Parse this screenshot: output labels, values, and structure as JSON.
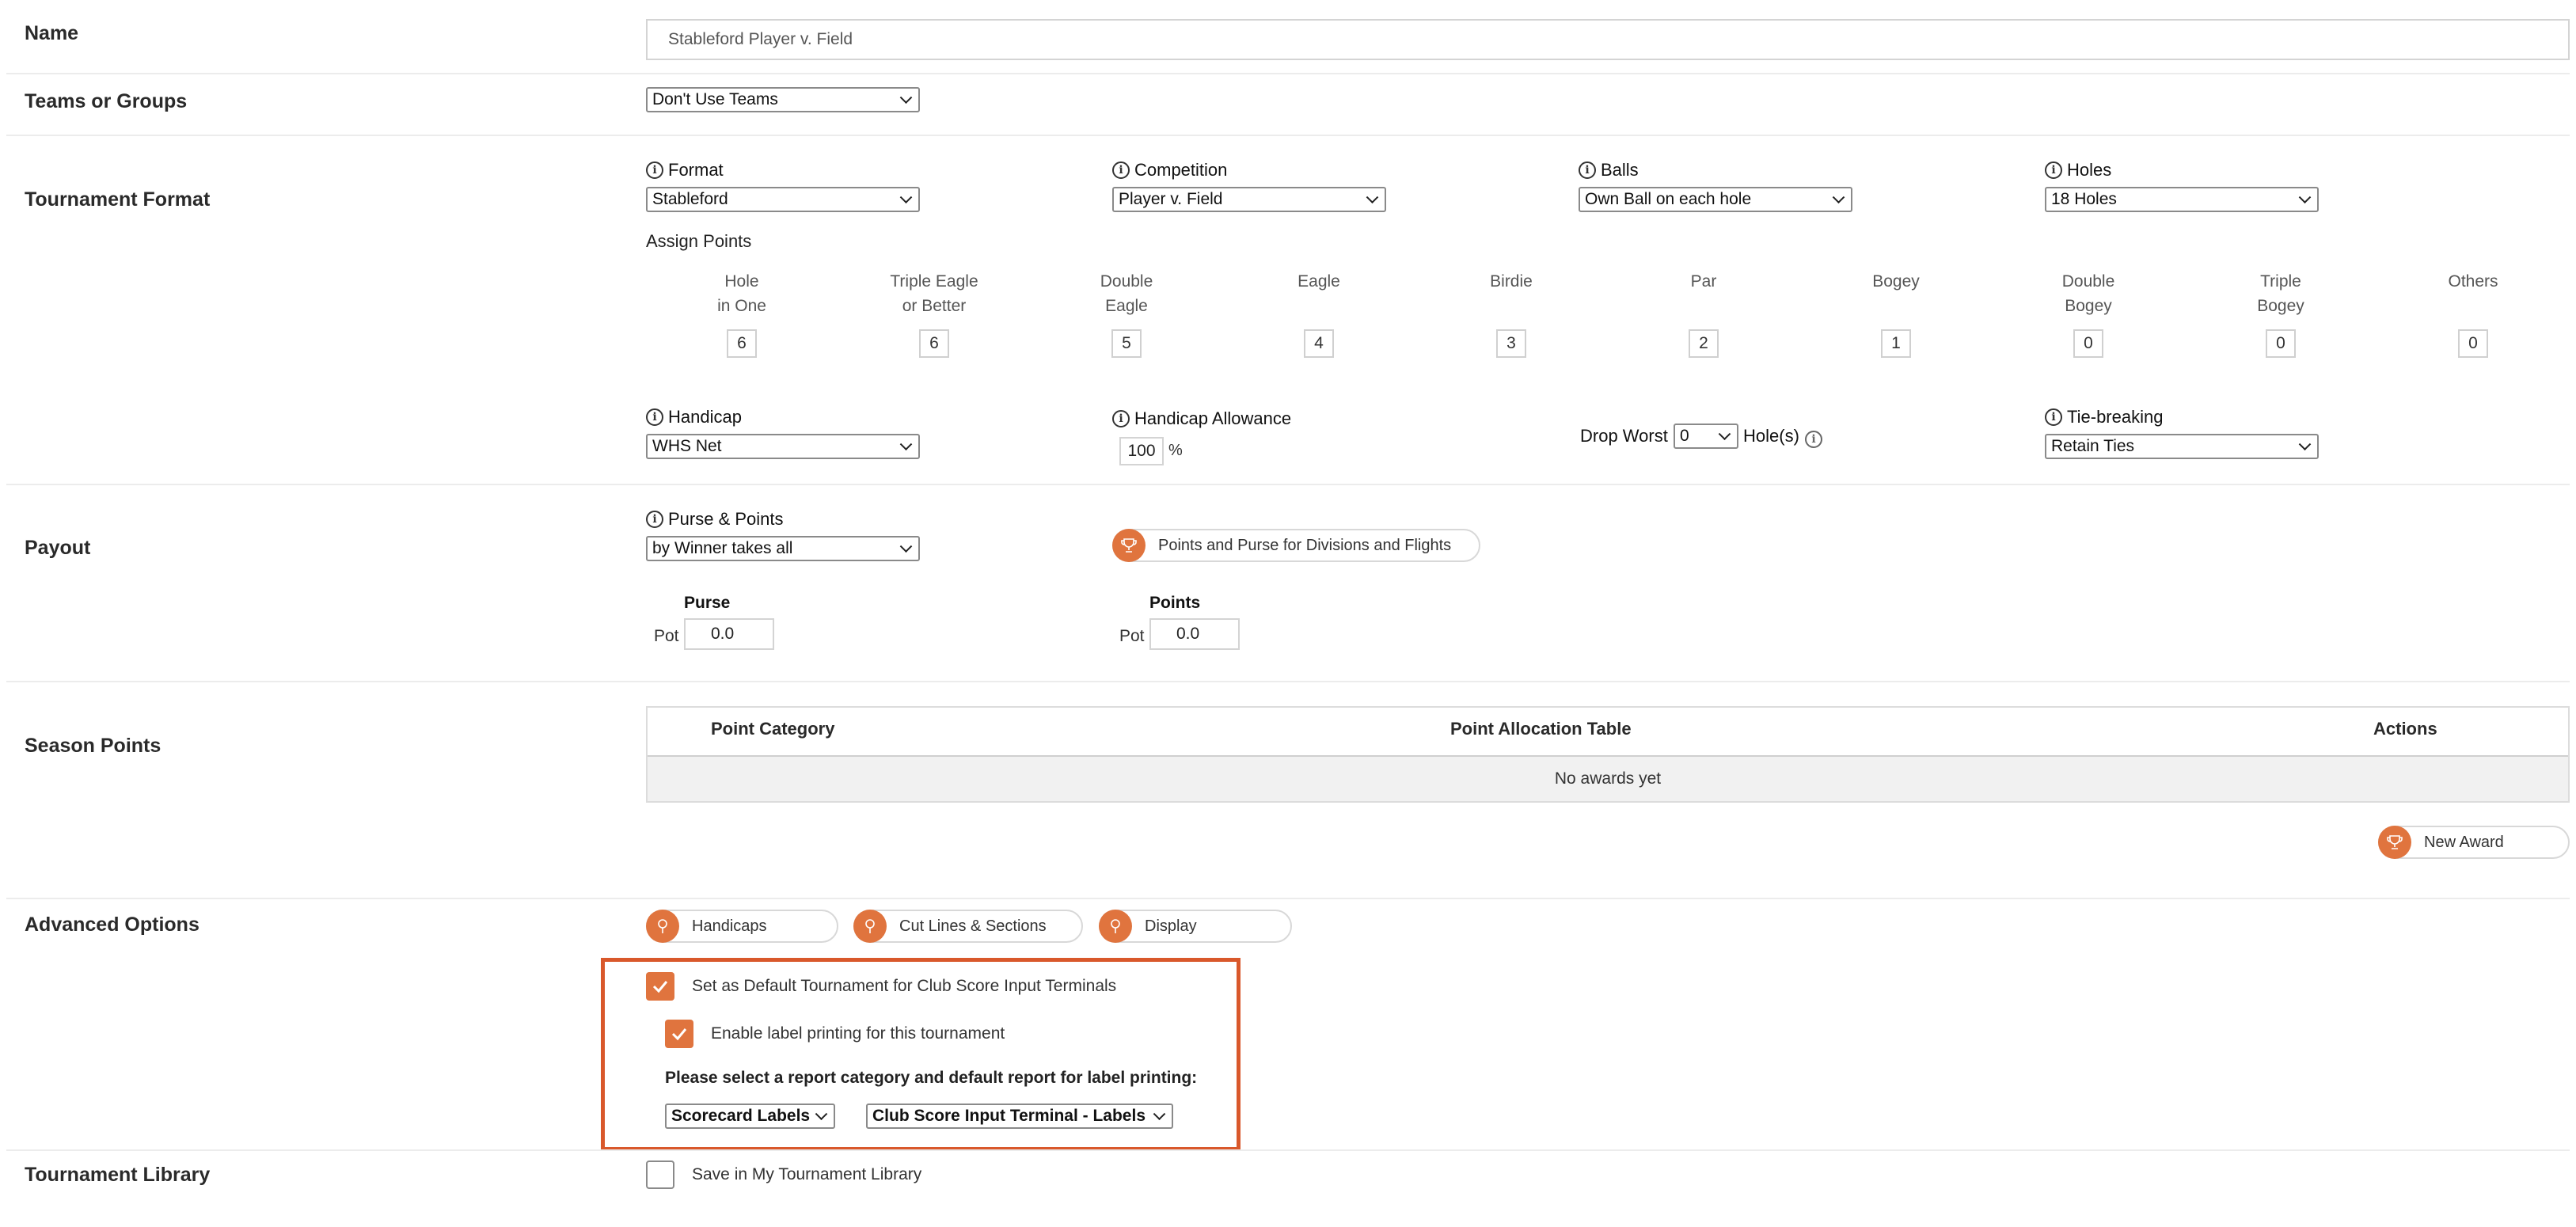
{
  "name_row": {
    "label": "Name",
    "value": "Stableford Player v. Field"
  },
  "teams_row": {
    "label": "Teams or Groups",
    "select": "Don't Use Teams"
  },
  "format_row": {
    "label": "Tournament Format",
    "format": {
      "label": "Format",
      "value": "Stableford"
    },
    "competition": {
      "label": "Competition",
      "value": "Player v. Field"
    },
    "balls": {
      "label": "Balls",
      "value": "Own Ball on each hole"
    },
    "holes": {
      "label": "Holes",
      "value": "18 Holes"
    },
    "assign_points_label": "Assign Points",
    "points": [
      {
        "line1": "Hole",
        "line2": "in One",
        "value": "6"
      },
      {
        "line1": "Triple Eagle",
        "line2": "or Better",
        "value": "6"
      },
      {
        "line1": "Double",
        "line2": "Eagle",
        "value": "5"
      },
      {
        "line1": "Eagle",
        "line2": "",
        "value": "4"
      },
      {
        "line1": "Birdie",
        "line2": "",
        "value": "3"
      },
      {
        "line1": "Par",
        "line2": "",
        "value": "2"
      },
      {
        "line1": "Bogey",
        "line2": "",
        "value": "1"
      },
      {
        "line1": "Double",
        "line2": "Bogey",
        "value": "0"
      },
      {
        "line1": "Triple",
        "line2": "Bogey",
        "value": "0"
      },
      {
        "line1": "Others",
        "line2": "",
        "value": "0"
      }
    ],
    "handicap": {
      "label": "Handicap",
      "value": "WHS Net"
    },
    "allowance": {
      "label": "Handicap Allowance",
      "value": "100",
      "unit": "%"
    },
    "drop_worst": {
      "label": "Drop Worst",
      "value": "0",
      "suffix": "Hole(s)"
    },
    "tie_breaking": {
      "label": "Tie-breaking",
      "value": "Retain Ties"
    }
  },
  "payout_row": {
    "label": "Payout",
    "purse_points": {
      "label": "Purse & Points",
      "value": "by Winner takes all"
    },
    "divisions_button": "Points and Purse for Divisions and Flights",
    "purse": {
      "header": "Purse",
      "pot_label": "Pot",
      "value": "0.0"
    },
    "points": {
      "header": "Points",
      "pot_label": "Pot",
      "value": "0.0"
    }
  },
  "season_row": {
    "label": "Season Points",
    "columns": [
      "Point Category",
      "Point Allocation Table",
      "Actions"
    ],
    "empty_text": "No awards yet",
    "new_award": "New Award"
  },
  "advanced_row": {
    "label": "Advanced Options",
    "buttons": [
      "Handicaps",
      "Cut Lines & Sections",
      "Display"
    ],
    "default_tournament": {
      "label": "Set as Default Tournament for Club Score Input Terminals",
      "checked": true
    },
    "label_printing": {
      "label": "Enable label printing for this tournament",
      "checked": true
    },
    "report_prompt": "Please select a report category and default report for label printing:",
    "report_category": "Scorecard Labels",
    "default_report": "Club Score Input Terminal - Labels"
  },
  "library_row": {
    "label": "Tournament Library",
    "save": {
      "label": "Save in My Tournament Library",
      "checked": false
    }
  },
  "colors": {
    "accent": "#e0743e",
    "highlight_border": "#d9582b"
  }
}
